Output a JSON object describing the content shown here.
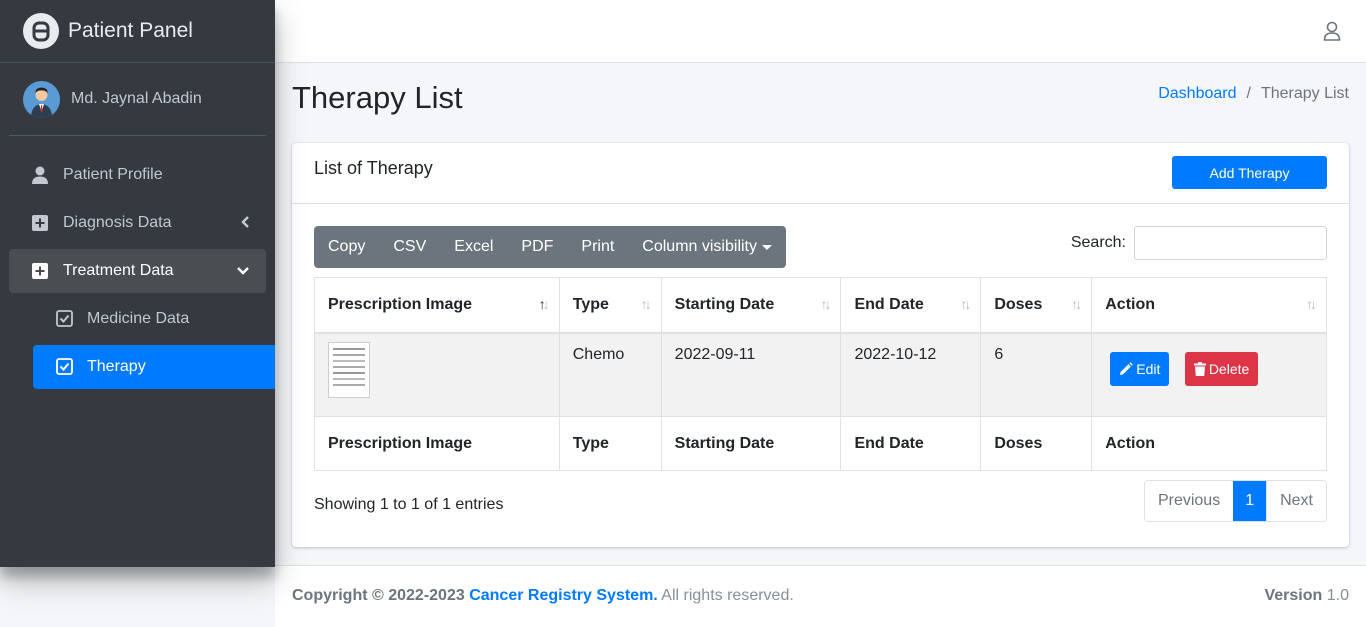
{
  "brand": {
    "title": "Patient Panel"
  },
  "user": {
    "name": "Md. Jaynal Abadin"
  },
  "sidebar": {
    "items": [
      {
        "label": "Patient Profile",
        "icon": "user-icon"
      },
      {
        "label": "Diagnosis Data",
        "icon": "plus-square-icon"
      },
      {
        "label": "Treatment Data",
        "icon": "plus-square-icon"
      }
    ],
    "subitems": [
      {
        "label": "Medicine Data",
        "icon": "check-square-icon"
      },
      {
        "label": "Therapy",
        "icon": "check-square-icon"
      }
    ]
  },
  "page": {
    "title": "Therapy List"
  },
  "breadcrumb": {
    "home": "Dashboard",
    "sep": "/",
    "current": "Therapy List"
  },
  "card": {
    "title": "List of Therapy",
    "add_button": "Add Therapy"
  },
  "toolbar": {
    "buttons": [
      "Copy",
      "CSV",
      "Excel",
      "PDF",
      "Print",
      "Column visibility"
    ],
    "search_label": "Search:"
  },
  "table": {
    "headers": [
      "Prescription Image",
      "Type",
      "Starting Date",
      "End Date",
      "Doses",
      "Action"
    ],
    "rows": [
      {
        "type": "Chemo",
        "start": "2022-09-11",
        "end": "2022-10-12",
        "doses": "6",
        "edit": "Edit",
        "delete": "Delete"
      }
    ]
  },
  "pagination": {
    "info": "Showing 1 to 1 of 1 entries",
    "previous": "Previous",
    "current": "1",
    "next": "Next"
  },
  "footer": {
    "copyright_prefix": "Copyright © 2022-2023",
    "system": "Cancer Registry System.",
    "rights": "All rights reserved.",
    "version_label": "Version",
    "version": "1.0"
  },
  "colors": {
    "primary": "#007bff",
    "danger": "#dc3545",
    "sidebar": "#343a40",
    "secondary": "#6c757d"
  }
}
